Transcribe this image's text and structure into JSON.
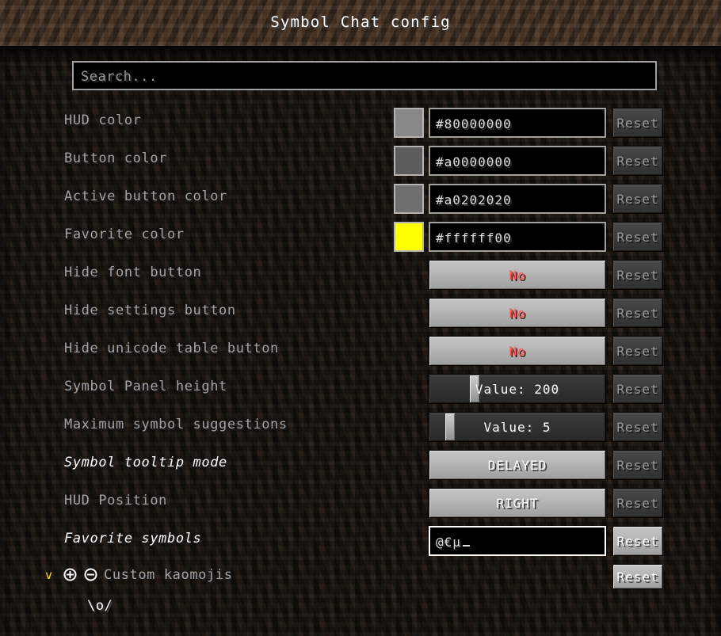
{
  "window": {
    "title": "Symbol Chat config"
  },
  "search": {
    "placeholder": "Search...",
    "value": ""
  },
  "labels": {
    "reset": "Reset"
  },
  "icons": {
    "chevron_down": "v",
    "add": "add-circle-icon",
    "remove": "remove-circle-icon"
  },
  "colors": {
    "accent_yellow": "#ffe000",
    "toggle_false_text": "#ff5555",
    "label": "#a3a3a3",
    "label_modified": "#ffffff",
    "header_dirt": "#37281d",
    "body_dirt": "#15110c"
  },
  "rows": [
    {
      "label": "HUD color",
      "type": "color",
      "swatch": "#888888",
      "value": "#80000000",
      "modified": false,
      "reset_enabled": false
    },
    {
      "label": "Button color",
      "type": "color",
      "swatch": "#5c5c5c",
      "value": "#a0000000",
      "modified": false,
      "reset_enabled": false
    },
    {
      "label": "Active button color",
      "type": "color",
      "swatch": "#6f6f6f",
      "value": "#a0202020",
      "modified": false,
      "reset_enabled": false
    },
    {
      "label": "Favorite color",
      "type": "color",
      "swatch": "#ffff00",
      "value": "#ffffff00",
      "modified": false,
      "reset_enabled": false
    },
    {
      "label": "Hide font button",
      "type": "toggle",
      "value": "No",
      "modified": false,
      "reset_enabled": false
    },
    {
      "label": "Hide settings button",
      "type": "toggle",
      "value": "No",
      "modified": false,
      "reset_enabled": false
    },
    {
      "label": "Hide unicode table button",
      "type": "toggle",
      "value": "No",
      "modified": false,
      "reset_enabled": false
    },
    {
      "label": "Symbol Panel height",
      "type": "slider",
      "value": "Value: 200",
      "slider_percent": 24,
      "modified": false,
      "reset_enabled": false
    },
    {
      "label": "Maximum symbol suggestions",
      "type": "slider",
      "value": "Value: 5",
      "slider_percent": 9,
      "modified": false,
      "reset_enabled": false
    },
    {
      "label": "Symbol tooltip mode",
      "type": "enum",
      "value": "DELAYED",
      "modified": true,
      "reset_enabled": false
    },
    {
      "label": "HUD Position",
      "type": "enum",
      "value": "RIGHT",
      "modified": false,
      "reset_enabled": false
    },
    {
      "label": "Favorite symbols",
      "type": "text",
      "value": "@€µ",
      "focused": true,
      "modified": true,
      "reset_enabled": true
    }
  ],
  "category": {
    "label": "Custom kaomojis",
    "expanded": true,
    "reset_enabled": true,
    "entries": [
      {
        "text": "\\o/"
      }
    ]
  }
}
